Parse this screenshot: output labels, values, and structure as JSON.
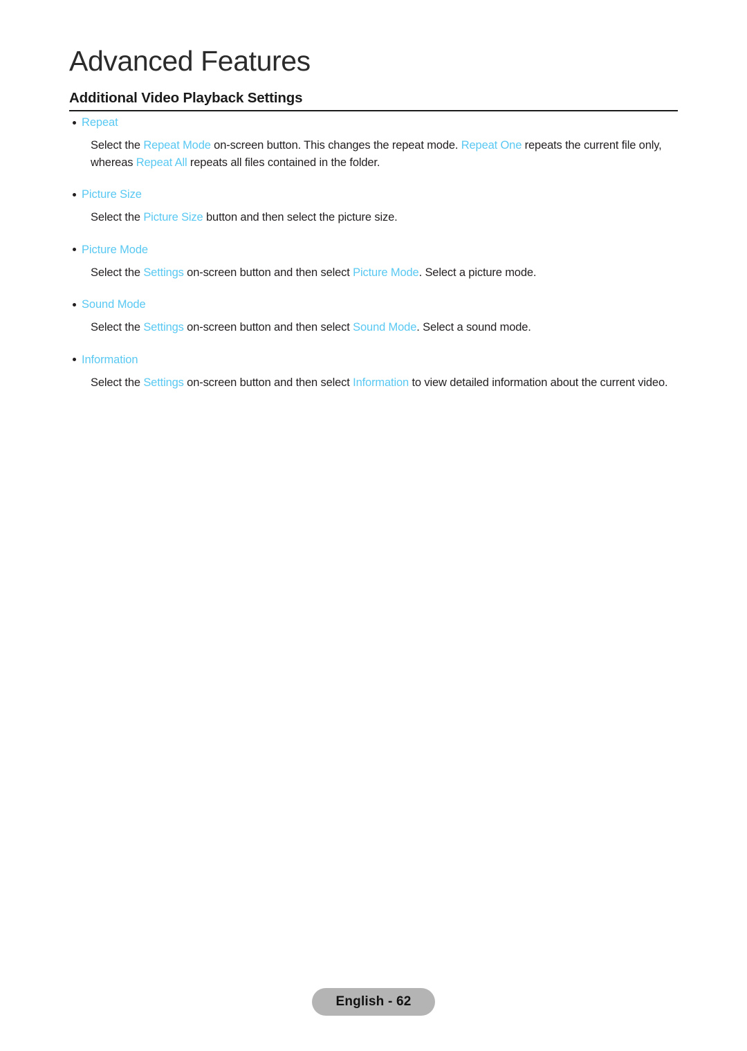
{
  "page": {
    "chapter_title": "Advanced Features",
    "section_heading": "Additional Video Playback Settings",
    "accent_color": "#59c8f2",
    "text_color": "#231f20",
    "pill_color": "#b4b4b4"
  },
  "sections": [
    {
      "label": "Repeat",
      "paragraph": {
        "parts": [
          {
            "text": "Select the ",
            "highlight": false
          },
          {
            "text": "Repeat Mode",
            "highlight": true
          },
          {
            "text": " on-screen button. This changes the repeat mode. ",
            "highlight": false
          },
          {
            "text": "Repeat One",
            "highlight": true
          },
          {
            "text": " repeats the current file only, whereas ",
            "highlight": false
          },
          {
            "text": "Repeat All",
            "highlight": true
          },
          {
            "text": " repeats all files contained in the folder.",
            "highlight": false
          }
        ]
      }
    },
    {
      "label": "Picture Size",
      "paragraph": {
        "parts": [
          {
            "text": "Select the ",
            "highlight": false
          },
          {
            "text": "Picture Size",
            "highlight": true
          },
          {
            "text": " button and then select the picture size.",
            "highlight": false
          }
        ]
      }
    },
    {
      "label": "Picture Mode",
      "paragraph": {
        "parts": [
          {
            "text": "Select the ",
            "highlight": false
          },
          {
            "text": "Settings",
            "highlight": true
          },
          {
            "text": " on-screen button and then select ",
            "highlight": false
          },
          {
            "text": "Picture Mode",
            "highlight": true
          },
          {
            "text": ". Select a picture mode.",
            "highlight": false
          }
        ]
      }
    },
    {
      "label": "Sound Mode",
      "paragraph": {
        "parts": [
          {
            "text": "Select the ",
            "highlight": false
          },
          {
            "text": "Settings",
            "highlight": true
          },
          {
            "text": " on-screen button and then select ",
            "highlight": false
          },
          {
            "text": "Sound Mode",
            "highlight": true
          },
          {
            "text": ". Select a sound mode.",
            "highlight": false
          }
        ]
      }
    },
    {
      "label": "Information",
      "paragraph": {
        "parts": [
          {
            "text": "Select the ",
            "highlight": false
          },
          {
            "text": "Settings",
            "highlight": true
          },
          {
            "text": " on-screen button and then select ",
            "highlight": false
          },
          {
            "text": "Information",
            "highlight": true
          },
          {
            "text": " to view detailed information about the current video.",
            "highlight": false
          }
        ]
      }
    }
  ],
  "footer": {
    "page_label": "English - 62"
  }
}
